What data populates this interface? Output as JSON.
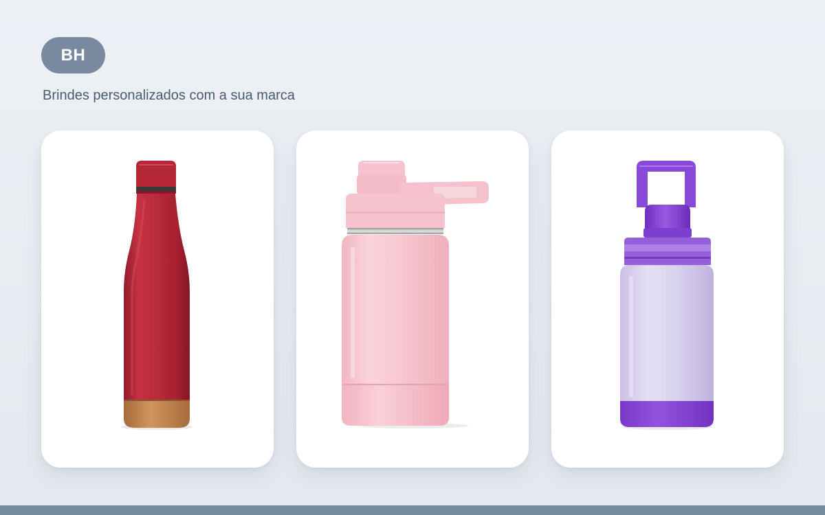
{
  "header": {
    "logo_text": "BH",
    "tagline": "Brindes personalizados com a sua marca"
  },
  "products": [
    {
      "image": "red-steel-bottle-with-cork-base",
      "color": "#b92a3a"
    },
    {
      "image": "pink-bottle-with-spout-lid",
      "color": "#f7c8d1"
    },
    {
      "image": "lilac-bottle-with-purple-handle-lid",
      "color": "#d9d2ee"
    }
  ],
  "colors": {
    "background": "#eaeef3",
    "logo_badge": "#7889a0",
    "tagline_text": "#4a5a6e",
    "card": "#ffffff",
    "bottom_bar": "#768aa0"
  }
}
